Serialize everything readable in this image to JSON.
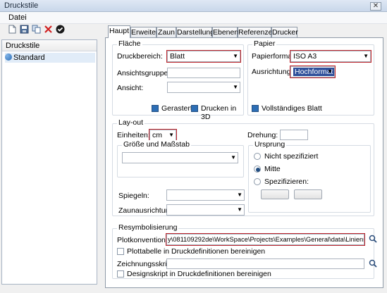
{
  "window": {
    "title": "Druckstile",
    "close_glyph": "✕"
  },
  "menu": {
    "datei": "Datei"
  },
  "toolbar": {
    "icons": [
      "new-icon",
      "save-icon",
      "copy-icon",
      "delete-icon",
      "check-icon"
    ]
  },
  "left_panel": {
    "header": "Druckstile",
    "items": [
      "Standard"
    ]
  },
  "tabs": [
    "Haupt",
    "Erweitert",
    "Zaun",
    "Darstellung",
    "Ebenen",
    "Referenzen",
    "Drucker"
  ],
  "flaeche": {
    "title": "Fläche",
    "druckbereich_label": "Druckbereich:",
    "druckbereich_value": "Blatt",
    "ansichtsgruppen_label": "Ansichtsgruppen:",
    "ansichtsgruppen_value": "",
    "ansicht_label": "Ansicht:",
    "ansicht_value": "",
    "gerastert": "Gerastert",
    "gerastert_checked": true,
    "drucken3d": "Drucken in 3D",
    "drucken3d_checked": true
  },
  "papier": {
    "title": "Papier",
    "papierformat_label": "Papierformat:",
    "papierformat_value": "ISO A3",
    "ausrichtung_label": "Ausrichtung:",
    "ausrichtung_value": "Hochformat",
    "vollstaendig": "Vollständiges Blatt",
    "vollstaendig_checked": true
  },
  "layout": {
    "title": "Lay-out",
    "einheiten_label": "Einheiten:",
    "einheiten_value": "cm",
    "drehung_label": "Drehung:",
    "drehung_value": "",
    "groesse_title": "Größe und Maßstab",
    "groesse_value": "",
    "spiegeln_label": "Spiegeln:",
    "spiegeln_value": "",
    "zaunausrichtung_label": "Zaunausrichtung:",
    "zaunausrichtung_value": "",
    "ursprung_title": "Ursprung",
    "ursprung_options": [
      "Nicht spezifiziert",
      "Mitte",
      "Spezifizieren:"
    ],
    "ursprung_selected": "Mitte"
  },
  "resymbolisierung": {
    "title": "Resymbolisierung",
    "plot_label": "Plotkonventionen:",
    "plot_value": "y\\081109292de\\WorkSpace\\Projects\\Examples\\General\\data\\Linienstärke.tbl",
    "plot_check_label": "Plottabelle in Druckdefinitionen bereinigen",
    "plot_check_checked": false,
    "zeichnung_label": "Zeichnungsskript:",
    "zeichnung_value": "",
    "design_check_label": "Designskript in Druckdefinitionen bereinigen",
    "design_check_checked": false
  },
  "accent": "#c0262d"
}
